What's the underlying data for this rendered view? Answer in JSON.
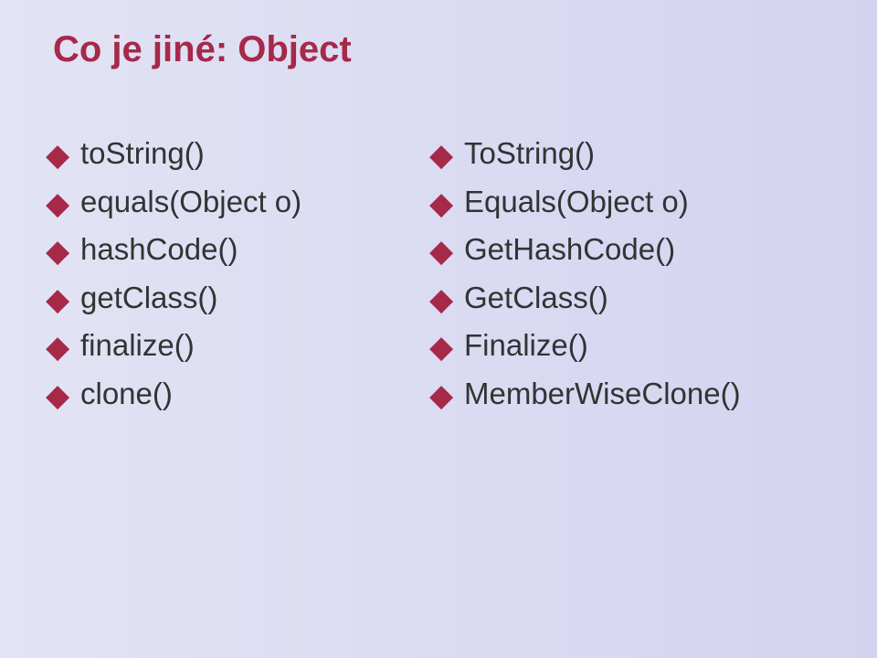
{
  "slide": {
    "title": "Co je jiné: Object",
    "columns": {
      "left": [
        {
          "label": "toString()"
        },
        {
          "label": "equals(Object o)"
        },
        {
          "label": "hashCode()"
        },
        {
          "label": "getClass()"
        },
        {
          "label": "finalize()"
        },
        {
          "label": "clone()"
        }
      ],
      "right": [
        {
          "label": "ToString()"
        },
        {
          "label": "Equals(Object o)"
        },
        {
          "label": "GetHashCode()"
        },
        {
          "label": "GetClass()"
        },
        {
          "label": "Finalize()"
        },
        {
          "label": "MemberWiseClone()"
        }
      ]
    }
  }
}
